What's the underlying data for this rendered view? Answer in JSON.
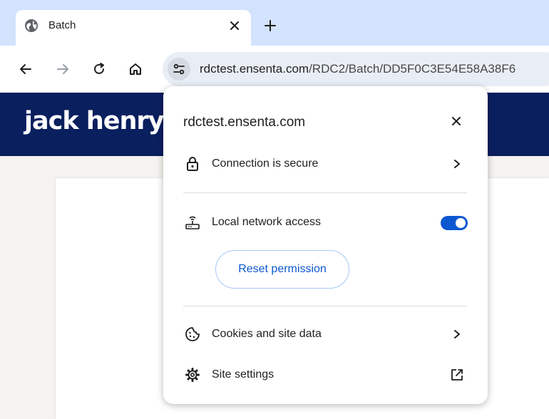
{
  "browser": {
    "tab": {
      "title": "Batch",
      "favicon": "globe-icon"
    },
    "url": {
      "host": "rdctest.ensenta.com",
      "path": "/RDC2/Batch/DD5F0C3E54E58A38F6"
    }
  },
  "page": {
    "logo_text": "jack henry",
    "banner_color": "#0a1f5e"
  },
  "site_info_popup": {
    "title": "rdctest.ensenta.com",
    "connection": {
      "label": "Connection is secure",
      "icon": "lock-icon"
    },
    "local_network": {
      "label": "Local network access",
      "icon": "router-icon",
      "enabled": true
    },
    "reset_permission_label": "Reset permission",
    "cookies": {
      "label": "Cookies and site data",
      "icon": "cookie-icon"
    },
    "site_settings": {
      "label": "Site settings",
      "icon": "gear-icon"
    }
  },
  "colors": {
    "accent": "#0b57d0",
    "tab_strip": "#d3e3fd",
    "omnibox": "#e9eef6"
  }
}
